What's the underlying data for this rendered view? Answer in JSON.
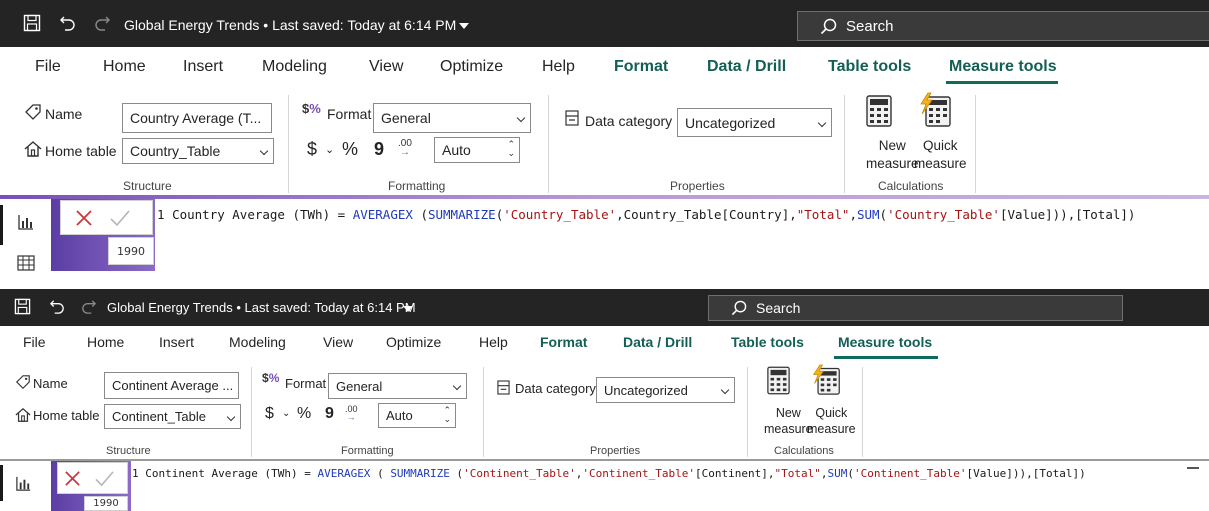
{
  "panels": [
    {
      "title": "Global Energy Trends • Last saved: Today at 6:14 PM",
      "search_placeholder": "Search",
      "tabs": [
        "File",
        "Home",
        "Insert",
        "Modeling",
        "View",
        "Optimize",
        "Help",
        "Format",
        "Data / Drill",
        "Table tools",
        "Measure tools"
      ],
      "structure": {
        "name_label": "Name",
        "name_value": "Country Average (T...",
        "home_table_label": "Home table",
        "home_table_value": "Country_Table",
        "group_label": "Structure"
      },
      "formatting": {
        "format_label": "Format",
        "format_value": "General",
        "currency": "$",
        "percent": "%",
        "comma": "9",
        "decimal": ".00",
        "auto_value": "Auto",
        "group_label": "Formatting"
      },
      "properties": {
        "data_category_label": "Data category",
        "data_category_value": "Uncategorized",
        "group_label": "Properties"
      },
      "calculations": {
        "new_measure_line1": "New",
        "new_measure_line2": "measure",
        "quick_measure_line1": "Quick",
        "quick_measure_line2": "measure",
        "group_label": "Calculations"
      },
      "formula_bar": {
        "line_no": "1",
        "parts": [
          [
            "tok",
            "Country Average "
          ],
          [
            "tok",
            "(TWh) = "
          ],
          [
            "kw",
            "AVERAGEX "
          ],
          [
            "tok",
            "("
          ],
          [
            "kw",
            "SUMMARIZE"
          ],
          [
            "tok",
            "("
          ],
          [
            "str",
            "'Country_Table'"
          ],
          [
            "tok",
            ",Country_Table[Country],"
          ],
          [
            "str",
            "\"Total\""
          ],
          [
            "tok",
            ","
          ],
          [
            "kw",
            "SUM"
          ],
          [
            "tok",
            "("
          ],
          [
            "str",
            "'Country_Table'"
          ],
          [
            "tok",
            "[Value])),[Total])"
          ]
        ],
        "cell_value": "1990"
      }
    },
    {
      "title": "Global Energy Trends • Last saved: Today at 6:14 PM",
      "search_placeholder": "Search",
      "tabs": [
        "File",
        "Home",
        "Insert",
        "Modeling",
        "View",
        "Optimize",
        "Help",
        "Format",
        "Data / Drill",
        "Table tools",
        "Measure tools"
      ],
      "structure": {
        "name_label": "Name",
        "name_value": "Continent Average ...",
        "home_table_label": "Home table",
        "home_table_value": "Continent_Table",
        "group_label": "Structure"
      },
      "formatting": {
        "format_label": "Format",
        "format_value": "General",
        "currency": "$",
        "percent": "%",
        "comma": "9",
        "decimal": ".00",
        "auto_value": "Auto",
        "group_label": "Formatting"
      },
      "properties": {
        "data_category_label": "Data category",
        "data_category_value": "Uncategorized",
        "group_label": "Properties"
      },
      "calculations": {
        "new_measure_line1": "New",
        "new_measure_line2": "measure",
        "quick_measure_line1": "Quick",
        "quick_measure_line2": "measure",
        "group_label": "Calculations"
      },
      "formula_bar": {
        "line_no": "1",
        "parts": [
          [
            "tok",
            "Continent Average "
          ],
          [
            "tok",
            "(TWh) = "
          ],
          [
            "kw",
            "AVERAGEX "
          ],
          [
            "tok",
            "( "
          ],
          [
            "kw",
            "SUMMARIZE "
          ],
          [
            "tok",
            "("
          ],
          [
            "str",
            "'Continent_Table'"
          ],
          [
            "tok",
            ","
          ],
          [
            "str",
            "'Continent_Table'"
          ],
          [
            "tok",
            "[Continent],"
          ],
          [
            "str",
            "\"Total\""
          ],
          [
            "tok",
            ","
          ],
          [
            "kw",
            "SUM"
          ],
          [
            "tok",
            "("
          ],
          [
            "str",
            "'Continent_Table'"
          ],
          [
            "tok",
            "[Value])),[Total])"
          ]
        ],
        "cell_value": "1990"
      }
    }
  ],
  "colors": {
    "titlebar_bg": "#242424",
    "context_tab": "#135f55",
    "accent_underline": "#0f6b5e",
    "formula_keyword": "#1f3ab8",
    "formula_string": "#a31515",
    "purple_band": "#5b3ea4"
  },
  "icons": [
    "save-icon",
    "undo-icon",
    "redo-icon",
    "search-icon",
    "tag-icon",
    "home-icon",
    "format-icon",
    "data-category-icon",
    "calculator-icon",
    "quick-measure-icon",
    "bar-chart-view-icon",
    "table-view-icon",
    "close-icon",
    "check-icon"
  ]
}
